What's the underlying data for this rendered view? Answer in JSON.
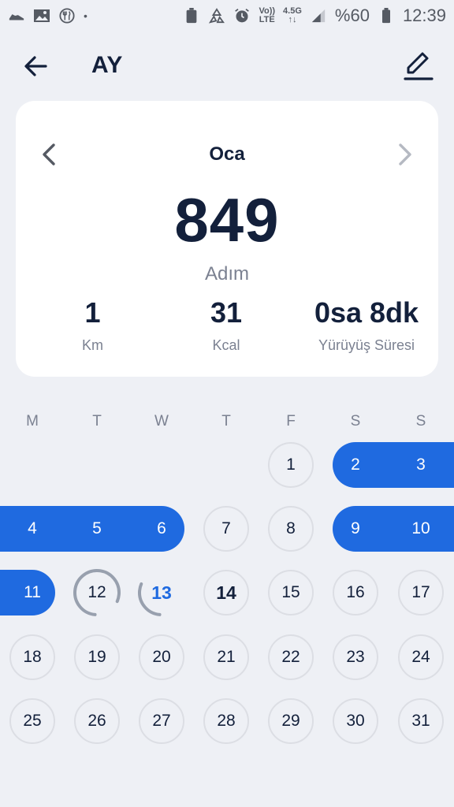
{
  "status_bar": {
    "battery_percent": "%60",
    "time": "12:39",
    "network_small": "4.5G",
    "volte_line1": "Vo))",
    "volte_line2": "LTE",
    "dot": "•"
  },
  "header": {
    "title": "AY",
    "back_icon": "arrow-left-icon",
    "edit_icon": "pencil-icon"
  },
  "summary": {
    "month": "Oca",
    "steps": "849",
    "steps_unit": "Adım",
    "stats": [
      {
        "value": "1",
        "label": "Km"
      },
      {
        "value": "31",
        "label": "Kcal"
      },
      {
        "value": "0sa 8dk",
        "label": "Yürüyüş Süresi"
      }
    ]
  },
  "calendar": {
    "weekdays": [
      "M",
      "T",
      "W",
      "T",
      "F",
      "S",
      "S"
    ],
    "days": [
      "1",
      "2",
      "3",
      "4",
      "5",
      "6",
      "7",
      "8",
      "9",
      "10",
      "11",
      "12",
      "13",
      "14",
      "15",
      "16",
      "17",
      "18",
      "19",
      "20",
      "21",
      "22",
      "23",
      "24",
      "25",
      "26",
      "27",
      "28",
      "29",
      "30",
      "31"
    ],
    "goal_reached_days": [
      "2",
      "3",
      "4",
      "5",
      "6",
      "9",
      "10",
      "11"
    ],
    "today": "14",
    "partial_progress": [
      {
        "day": "12",
        "progress": 0.8
      },
      {
        "day": "13",
        "progress": 0.3
      }
    ]
  },
  "colors": {
    "accent": "#1f6ae0",
    "text_dark": "#13203b",
    "text_muted": "#7b8191",
    "background": "#eef0f5",
    "card": "#ffffff"
  }
}
